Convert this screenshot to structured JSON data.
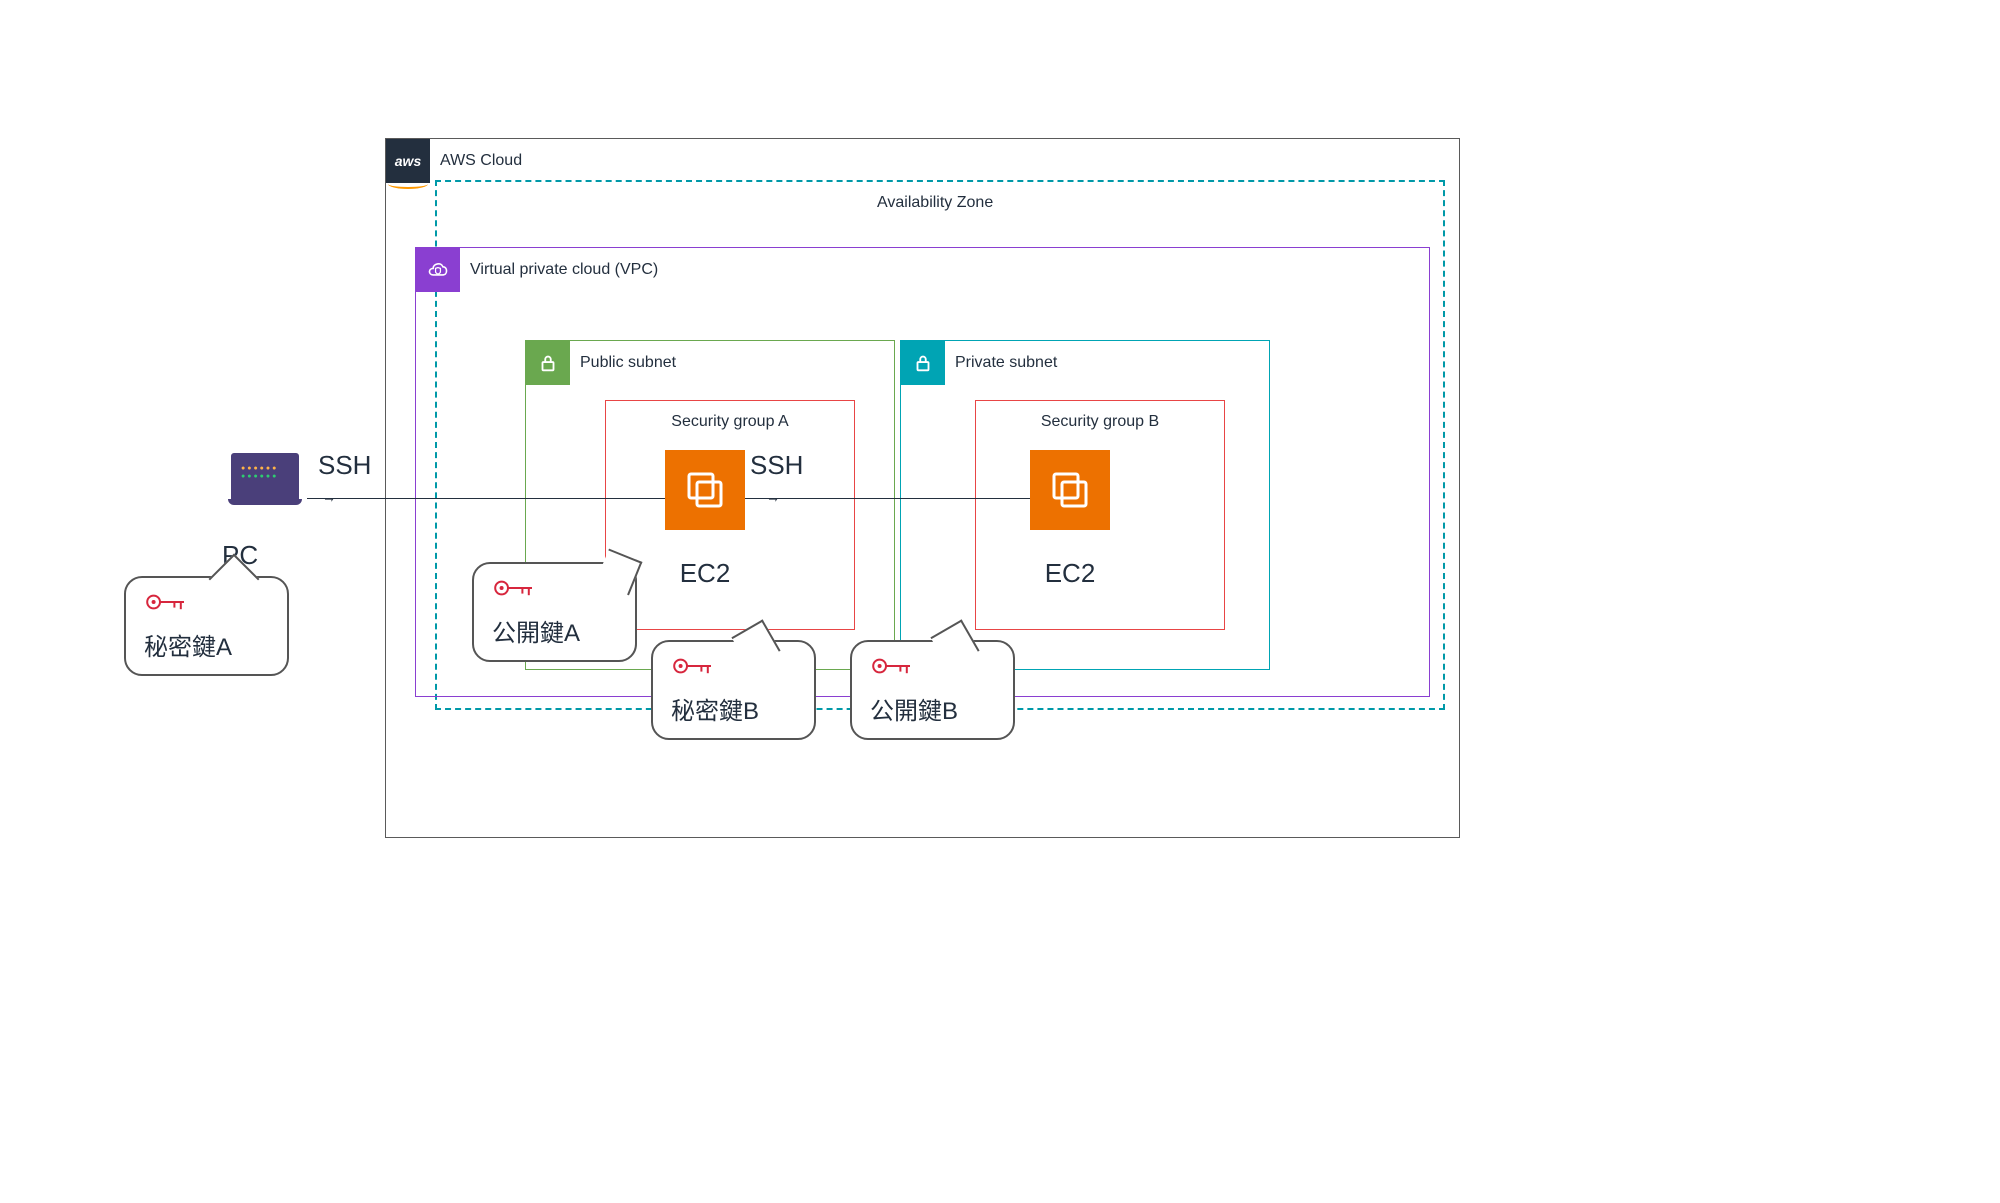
{
  "aws": {
    "badge_text": "aws",
    "cloud_label": "AWS Cloud"
  },
  "az": {
    "label": "Availability Zone"
  },
  "vpc": {
    "label": "Virtual private cloud (VPC)"
  },
  "public_subnet": {
    "label": "Public subnet"
  },
  "private_subnet": {
    "label": "Private subnet"
  },
  "sg": {
    "a_label": "Security group A",
    "b_label": "Security group B"
  },
  "ec2": {
    "a_label": "EC2",
    "b_label": "EC2"
  },
  "pc": {
    "label": "PC"
  },
  "ssh": {
    "label1": "SSH",
    "label2": "SSH"
  },
  "arrows": {
    "glyph": "→"
  },
  "keys": {
    "privateA": "秘密鍵A",
    "publicA": "公開鍵A",
    "privateB": "秘密鍵B",
    "publicB": "公開鍵B"
  },
  "colors": {
    "aws_dark": "#232f3e",
    "aws_orange": "#ed7100",
    "vpc_purple": "#8a3fd1",
    "public_green": "#6aa84f",
    "private_teal": "#00a4b4",
    "sg_red": "#e84545",
    "key_red": "#d7263d"
  }
}
